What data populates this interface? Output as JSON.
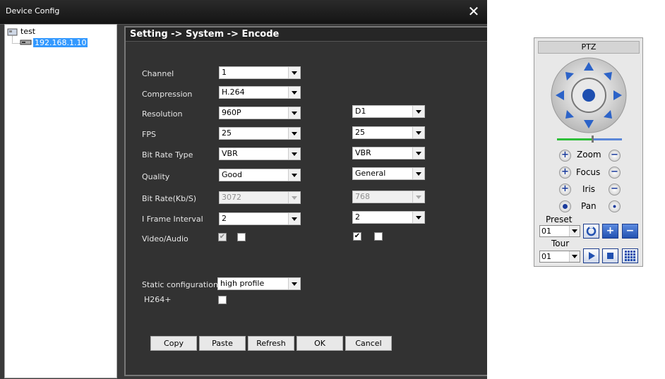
{
  "window": {
    "title": "Device Config",
    "close_glyph": "✕"
  },
  "tree": {
    "root": "test",
    "child": "192.168.1.10"
  },
  "header": "Setting -> System -> Encode",
  "fields": [
    {
      "label": "Channel",
      "main": "1",
      "sub": null
    },
    {
      "label": "Compression",
      "main": "H.264",
      "sub": null
    },
    {
      "label": "Resolution",
      "main": "960P",
      "sub": "D1"
    },
    {
      "label": "FPS",
      "main": "25",
      "sub": "25"
    },
    {
      "label": "Bit Rate Type",
      "main": "VBR",
      "sub": "VBR"
    },
    {
      "label": "Quality",
      "main": "Good",
      "sub": "General"
    },
    {
      "label": "Bit Rate(Kb/S)",
      "main": "3072",
      "sub": "768",
      "disabled": true
    },
    {
      "label": "I Frame Interval",
      "main": "2",
      "sub": "2"
    },
    {
      "label": "Video/Audio",
      "main_video": true,
      "main_audio": false,
      "sub_video": true,
      "sub_audio": false
    }
  ],
  "static_config": {
    "label": "Static configuration of",
    "value": "high profile"
  },
  "h264plus": {
    "label": "H264+",
    "checked": false
  },
  "buttons": {
    "copy": "Copy",
    "paste": "Paste",
    "refresh": "Refresh",
    "ok": "OK",
    "cancel": "Cancel"
  },
  "ptz": {
    "title": "PTZ",
    "zoom": "Zoom",
    "focus": "Focus",
    "iris": "Iris",
    "pan": "Pan",
    "preset_label": "Preset",
    "preset_value": "01",
    "tour_label": "Tour",
    "tour_value": "01",
    "plus_glyph": "+",
    "minus_glyph": "−",
    "check_glyph": "✔"
  }
}
